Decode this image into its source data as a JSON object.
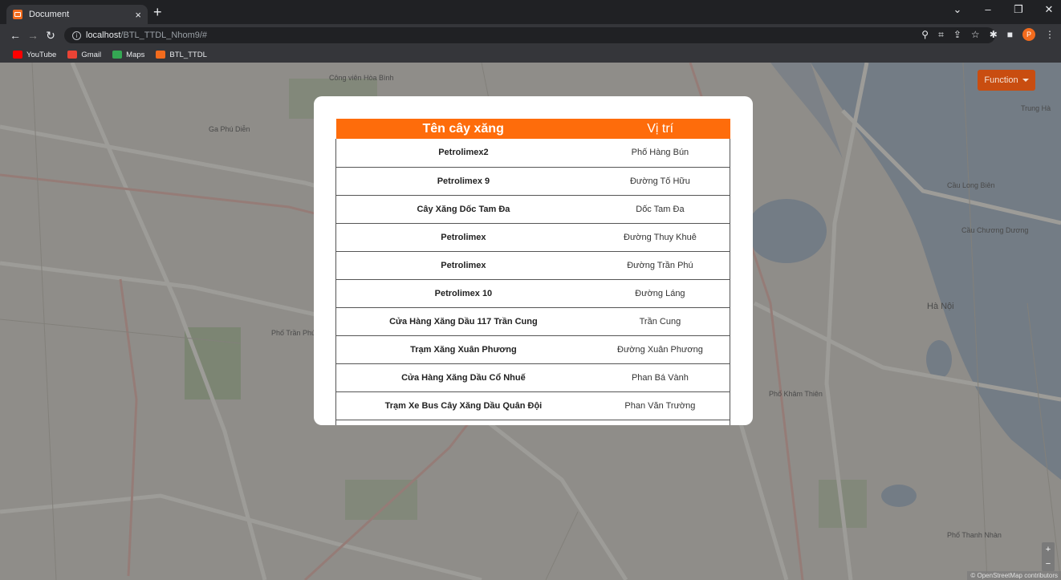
{
  "browser": {
    "tab_title": "Document",
    "tab_close": "×",
    "new_tab": "+",
    "url_host": "localhost",
    "url_path": "/BTL_TTDL_Nhom9/#",
    "profile_initial": "P",
    "bookmarks": [
      {
        "label": "YouTube",
        "icon": "youtube-icon"
      },
      {
        "label": "Gmail",
        "icon": "gmail-icon"
      },
      {
        "label": "Maps",
        "icon": "maps-icon"
      },
      {
        "label": "BTL_TTDL",
        "icon": "bookmark-favicon-icon"
      }
    ]
  },
  "map": {
    "function_button": "Function",
    "zoom_in": "+",
    "zoom_out": "−",
    "attribution": "© OpenStreetMap contributors",
    "labels": {
      "ga_phu_dien": "Ga Phú Diễn",
      "ha_noi": "Hà Nội",
      "cau_long_bien": "Cầu Long Biên",
      "cau_chuong_duong": "Cầu Chương Dương",
      "trung_ha": "Trung Hà",
      "pho_tran_phu": "Phố Trần Phú",
      "cong_vien_hoa_binh": "Công viên Hòa Bình",
      "pho_kham_thien": "Phố Khâm Thiên",
      "pho_thanh_nhan": "Phố Thanh Nhàn"
    }
  },
  "table": {
    "headers": [
      "Tên cây xăng",
      "Vị trí"
    ],
    "rows": [
      {
        "name": "Petrolimex2",
        "location": "Phố Hàng Bún"
      },
      {
        "name": "Petrolimex 9",
        "location": "Đường Tố Hữu"
      },
      {
        "name": "Cây Xăng Dốc Tam Đa",
        "location": "Dốc Tam Đa"
      },
      {
        "name": "Petrolimex",
        "location": "Đường Thuy Khuê"
      },
      {
        "name": "Petrolimex",
        "location": "Đường Trần Phú"
      },
      {
        "name": "Petrolimex 10",
        "location": "Đường Láng"
      },
      {
        "name": "Cửa Hàng Xăng Dầu 117 Trần Cung",
        "location": "Trần Cung"
      },
      {
        "name": "Trạm Xăng Xuân Phương",
        "location": "Đường Xuân Phương"
      },
      {
        "name": "Cửa Hàng Xăng Dầu Cổ Nhuế",
        "location": "Phan Bá Vành"
      },
      {
        "name": "Trạm Xe Bus Cây Xăng Dầu Quân Đội",
        "location": "Phan Văn Trường"
      },
      {
        "name": "",
        "location": ""
      }
    ]
  }
}
